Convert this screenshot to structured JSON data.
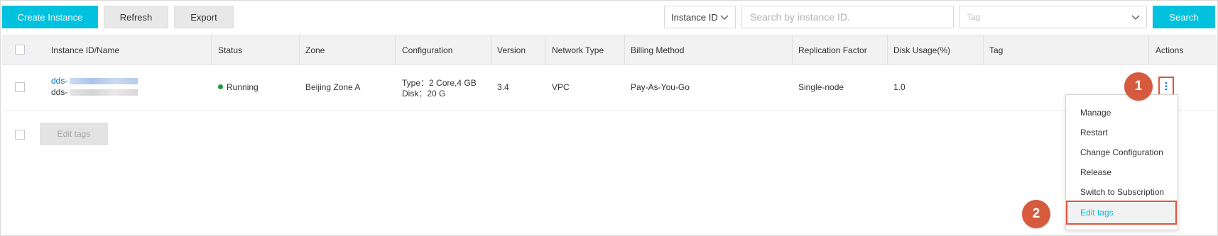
{
  "toolbar": {
    "create_label": "Create Instance",
    "refresh_label": "Refresh",
    "export_label": "Export",
    "filter_select": "Instance ID",
    "search_placeholder": "Search by instance ID.",
    "tag_placeholder": "Tag",
    "search_label": "Search"
  },
  "colors": {
    "accent": "#00c1de",
    "link": "#0070cc",
    "running": "#1e9c3c",
    "highlight": "#e2543c",
    "badge": "#d65a3d"
  },
  "table": {
    "columns": [
      "Instance ID/Name",
      "Status",
      "Zone",
      "Configuration",
      "Version",
      "Network Type",
      "Billing Method",
      "Replication Factor",
      "Disk Usage(%)",
      "Tag",
      "Actions"
    ],
    "rows": [
      {
        "id_prefix": "dds-",
        "name_prefix": "dds-",
        "status": "Running",
        "zone": "Beijing Zone A",
        "config_type": "Type：2 Core,4 GB",
        "config_disk": "Disk：20 G",
        "version": "3.4",
        "network": "VPC",
        "billing": "Pay-As-You-Go",
        "replication": "Single-node",
        "disk_usage": "1.0",
        "tag": ""
      }
    ]
  },
  "footer": {
    "edit_tags_label": "Edit tags"
  },
  "actions_menu": {
    "trigger_icon": "more-vertical-icon",
    "items": [
      "Manage",
      "Restart",
      "Change Configuration",
      "Release",
      "Switch to Subscription",
      "Edit tags"
    ]
  },
  "callouts": [
    "1",
    "2"
  ]
}
